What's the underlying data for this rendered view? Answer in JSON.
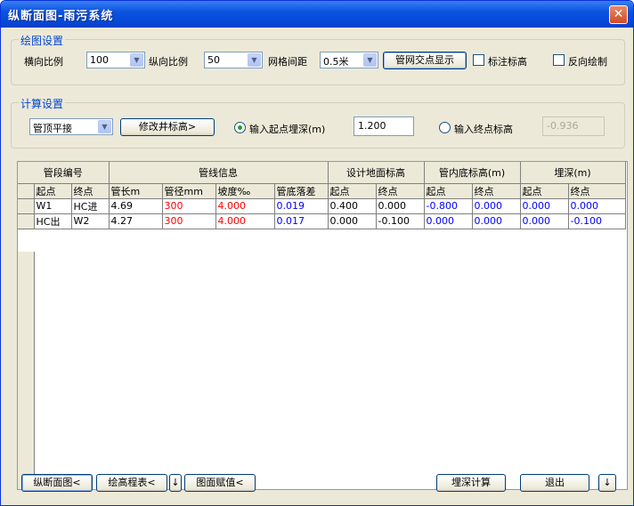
{
  "window": {
    "title": "纵断面图-雨污系统",
    "close_glyph": "✕"
  },
  "draw_settings": {
    "legend": "绘图设置",
    "h_scale_label": "横向比例",
    "h_scale_value": "100",
    "v_scale_label": "纵向比例",
    "v_scale_value": "50",
    "grid_spacing_label": "网格间距",
    "grid_spacing_value": "0.5米",
    "show_intersections_button": "管网交点显示",
    "mark_elevation_label": "标注标高",
    "reverse_draw_label": "反向绘制"
  },
  "calc_settings": {
    "legend": "计算设置",
    "mode_value": "管顶平接",
    "modify_elev_button": "修改井标高>",
    "start_depth_label": "输入起点埋深(m)",
    "start_depth_value": "1.200",
    "end_elev_label": "输入终点标高",
    "end_elev_value": "-0.936"
  },
  "table": {
    "group_headers": [
      "管段编号",
      "管线信息",
      "设计地面标高",
      "管内底标高(m)",
      "埋深(m)"
    ],
    "columns": [
      "起点",
      "终点",
      "管长m",
      "管径mm",
      "坡度‰",
      "管底落差",
      "起点",
      "终点",
      "起点",
      "终点",
      "起点",
      "终点"
    ],
    "rows": [
      [
        "W1",
        "HC进",
        "4.69",
        "300",
        "4.000",
        "0.019",
        "0.400",
        "0.000",
        "-0.800",
        "0.000",
        "0.000",
        "0.000"
      ],
      [
        "HC出",
        "W2",
        "4.27",
        "300",
        "4.000",
        "0.017",
        "0.000",
        "-0.100",
        "0.000",
        "0.000",
        "0.000",
        "-0.100"
      ]
    ]
  },
  "footer": {
    "profile_button": "纵断面图<",
    "elev_table_button": "绘高程表<",
    "down_arrow": "↓",
    "assign_button": "图面赋值<",
    "depth_calc_button": "埋深计算",
    "exit_button": "退出"
  },
  "colors": {
    "title_bar": "#0a54e0",
    "legend_text": "#0046d5",
    "red_value": "#ff0000",
    "blue_value": "#0000ff"
  }
}
